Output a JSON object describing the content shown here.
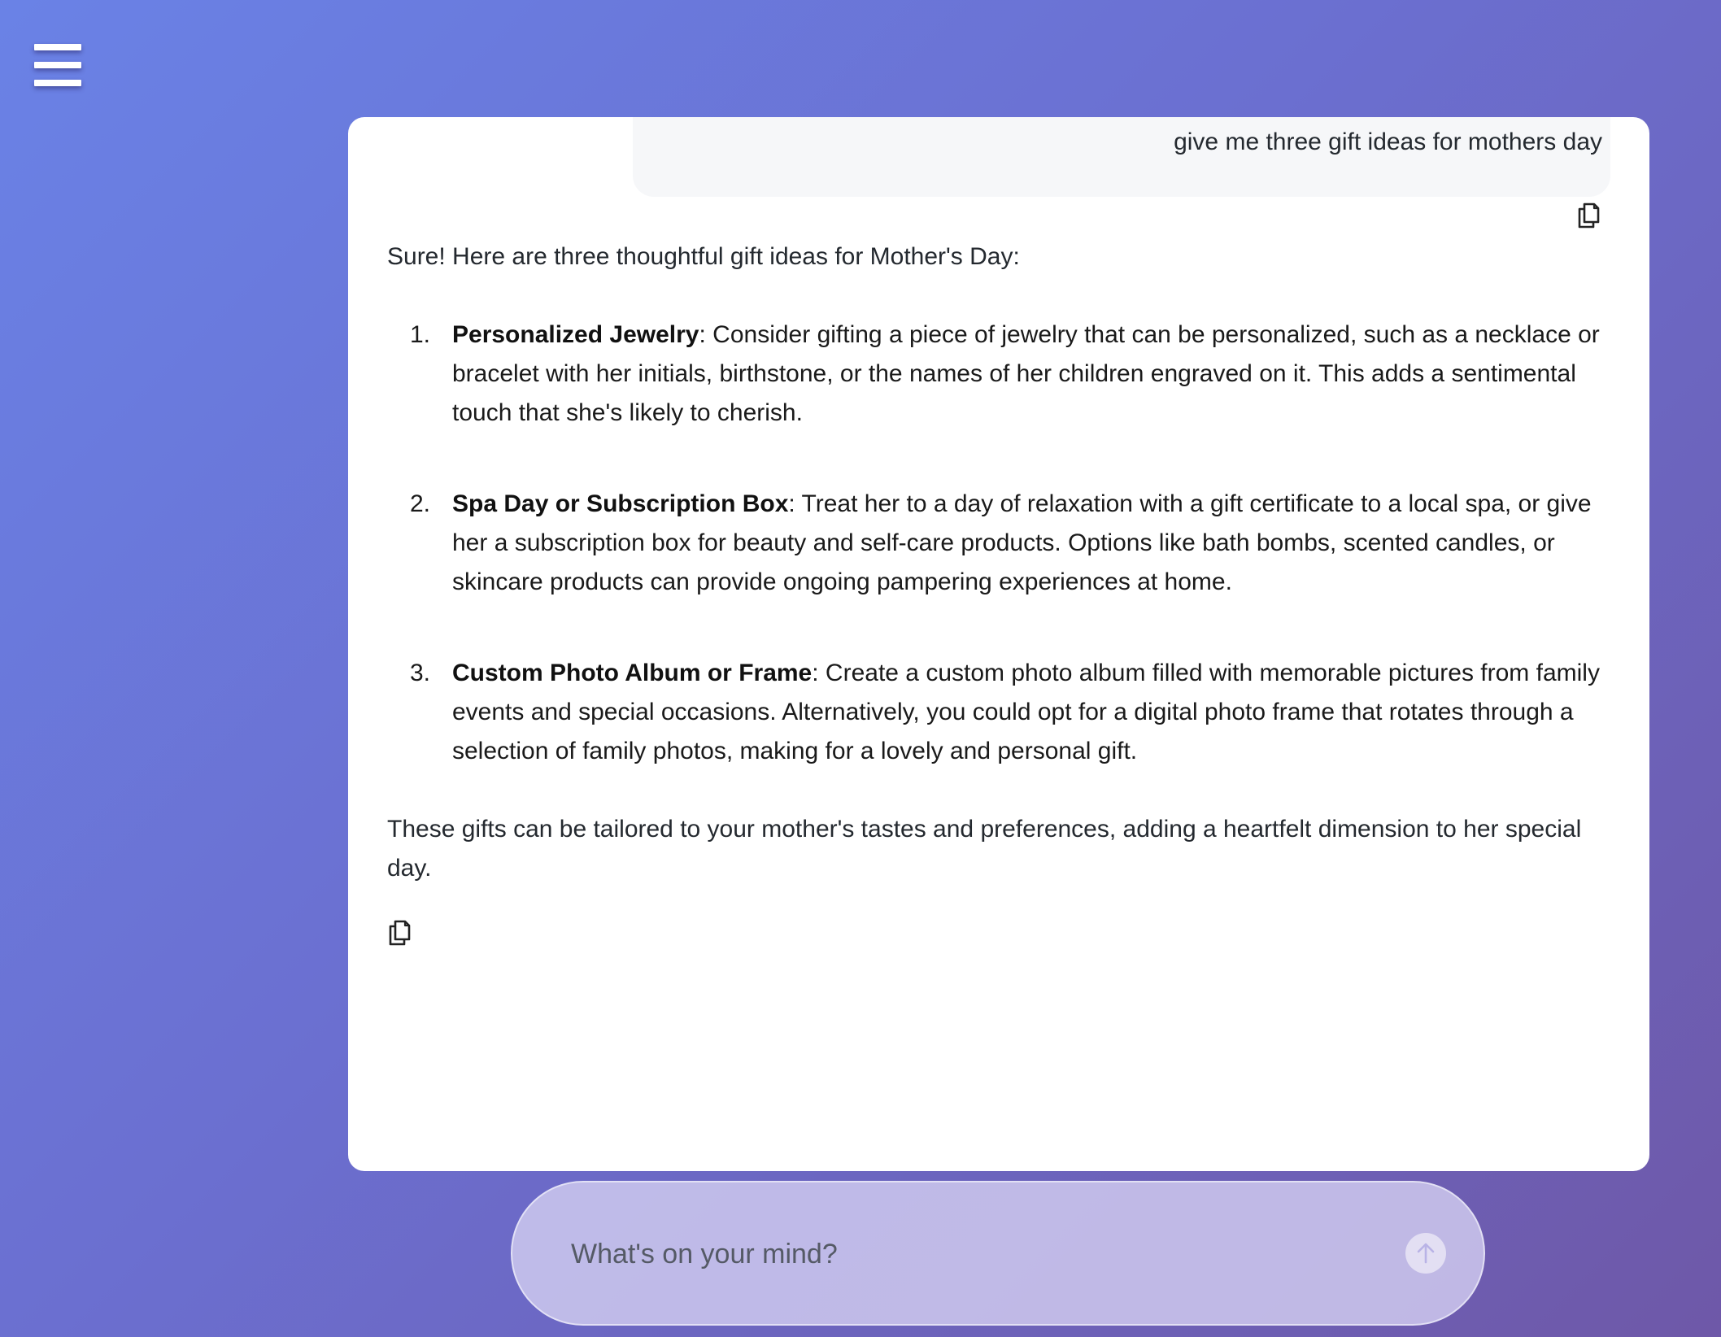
{
  "menu": {
    "icon": "hamburger-menu-icon"
  },
  "conversation": {
    "user_message": "give me three gift ideas for mothers day",
    "assistant": {
      "intro": "Sure! Here are three thoughtful gift ideas for Mother's Day:",
      "items": [
        {
          "number": "1.",
          "title": "Personalized Jewelry",
          "text": ": Consider gifting a piece of jewelry that can be personalized, such as a necklace or bracelet with her initials, birthstone, or the names of her children engraved on it. This adds a sentimental touch that she's likely to cherish."
        },
        {
          "number": "2.",
          "title": "Spa Day or Subscription Box",
          "text": ": Treat her to a day of relaxation with a gift certificate to a local spa, or give her a subscription box for beauty and self-care products. Options like bath bombs, scented candles, or skincare products can provide ongoing pampering experiences at home."
        },
        {
          "number": "3.",
          "title": "Custom Photo Album or Frame",
          "text": ": Create a custom photo album filled with memorable pictures from family events and special occasions. Alternatively, you could opt for a digital photo frame that rotates through a selection of family photos, making for a lovely and personal gift."
        }
      ],
      "outro": "These gifts can be tailored to your mother's tastes and preferences, adding a heartfelt dimension to her special day."
    },
    "copy_icon": "copy-icon"
  },
  "input": {
    "placeholder": "What's on your mind?",
    "value": "",
    "send_icon": "arrow-up-icon"
  },
  "colors": {
    "background_start": "#6a82e6",
    "background_end": "#6e58a8",
    "panel": "#ffffff",
    "user_bubble": "#f6f7f9",
    "input_bar": "#d2cdf0"
  }
}
